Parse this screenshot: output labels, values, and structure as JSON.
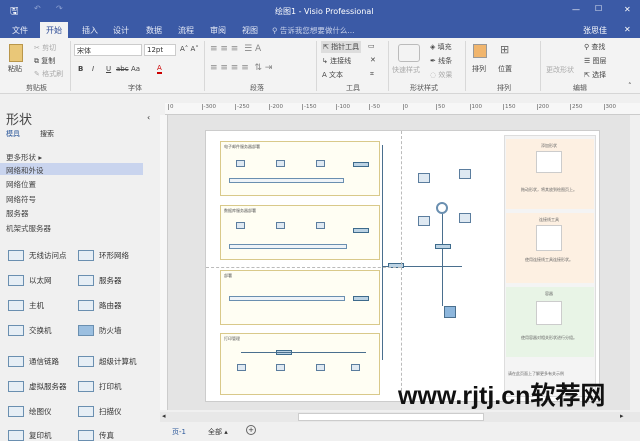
{
  "window": {
    "title": "绘图1 - Visio Professional",
    "minimize": "—",
    "maximize": "☐",
    "close": "✕",
    "user": "张思佳",
    "ribbon_close": "✕"
  },
  "tabs": [
    "文件",
    "开始",
    "插入",
    "设计",
    "数据",
    "流程",
    "审阅",
    "视图"
  ],
  "tell_me": "告诉我您想要做什么...",
  "ribbon": {
    "clipboard": {
      "label": "剪贴板",
      "paste": "粘贴",
      "cut": "剪切",
      "copy": "复制",
      "format_painter": "格式刷"
    },
    "font": {
      "label": "字体",
      "font_name": "宋体",
      "font_size": "12pt",
      "bold": "B",
      "italic": "I",
      "underline": "U",
      "strike": "abc",
      "case": "Aa",
      "color": "A"
    },
    "paragraph": {
      "label": "段落"
    },
    "tools": {
      "label": "工具",
      "pointer": "指针工具",
      "connector": "连接线",
      "text": "文本"
    },
    "shape_styles": {
      "label": "形状样式",
      "quick_styles": "快速样式",
      "fill": "填充",
      "line": "线条",
      "effects": "效果"
    },
    "arrange": {
      "label": "排列",
      "arrange": "排列",
      "position": "位置"
    },
    "editing": {
      "label": "编辑",
      "change_shape": "更改形状",
      "find": "查找",
      "layers": "图层",
      "select": "选择"
    }
  },
  "shapes_panel": {
    "title": "形状",
    "tab_stencils": "模具",
    "tab_search": "搜索",
    "more_shapes": "更多形状",
    "stencils": [
      "网络和外设",
      "网络位置",
      "网络符号",
      "服务器",
      "机架式服务器"
    ],
    "items": [
      "无线访问点",
      "环形网络",
      "以太网",
      "服务器",
      "主机",
      "路由器",
      "交换机",
      "防火墙",
      "通信链路",
      "超级计算机",
      "虚拟服务器",
      "打印机",
      "绘图仪",
      "扫描仪",
      "复印机",
      "传真"
    ]
  },
  "ruler_ticks": [
    "0",
    "-300",
    "-250",
    "-200",
    "-150",
    "-100",
    "-50",
    "0",
    "50",
    "100",
    "150",
    "200",
    "250",
    "300"
  ],
  "diagram": {
    "containers": [
      "电子邮件服务器部署",
      "数据库服务器部署",
      "部署",
      "打印管理"
    ],
    "tips": [
      {
        "title": "添加形状",
        "text": "拖动形状，将其放到绘图页上。"
      },
      {
        "title": "连接线工具",
        "text": "使用连接线工具连接形状。"
      },
      {
        "title": "容器",
        "text": "使用容器对相关形状进行分组。"
      }
    ],
    "footer_note": "请在此页面上了解更多有关示例"
  },
  "watermark": "www.rjtj.cn软荐网",
  "page_tabs": {
    "page1": "页-1",
    "all": "全部",
    "add": "+"
  }
}
